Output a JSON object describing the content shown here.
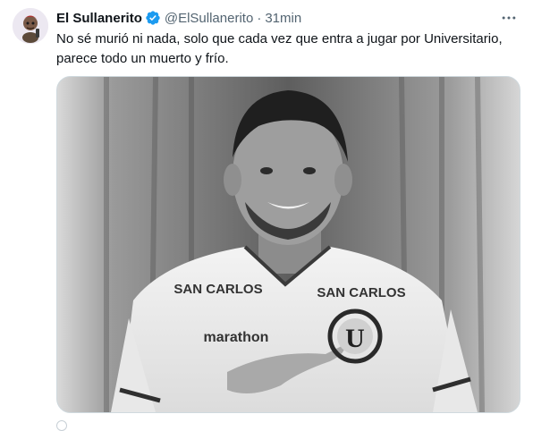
{
  "tweet": {
    "author_name": "El Sullanerito",
    "author_handle": "@ElSullanerito",
    "separator": "·",
    "timestamp": "31min",
    "text_line1": "No sé murió ni nada, solo que cada vez que entra a jugar por Universitario,",
    "text_line2": "parece todo un muerto y frío."
  },
  "media": {
    "shirt_sponsor_left": "SAN CARLOS",
    "shirt_sponsor_right": "SAN CARLOS",
    "shirt_brand": "marathon",
    "crest_letter": "U"
  },
  "icons": {
    "verified": "verified-badge-icon",
    "more": "more-options-icon",
    "reply": "reply-icon"
  },
  "colors": {
    "verified_blue": "#1d9bf0",
    "muted_text": "#536471",
    "primary_text": "#0f1419",
    "border": "#cfd9de"
  }
}
